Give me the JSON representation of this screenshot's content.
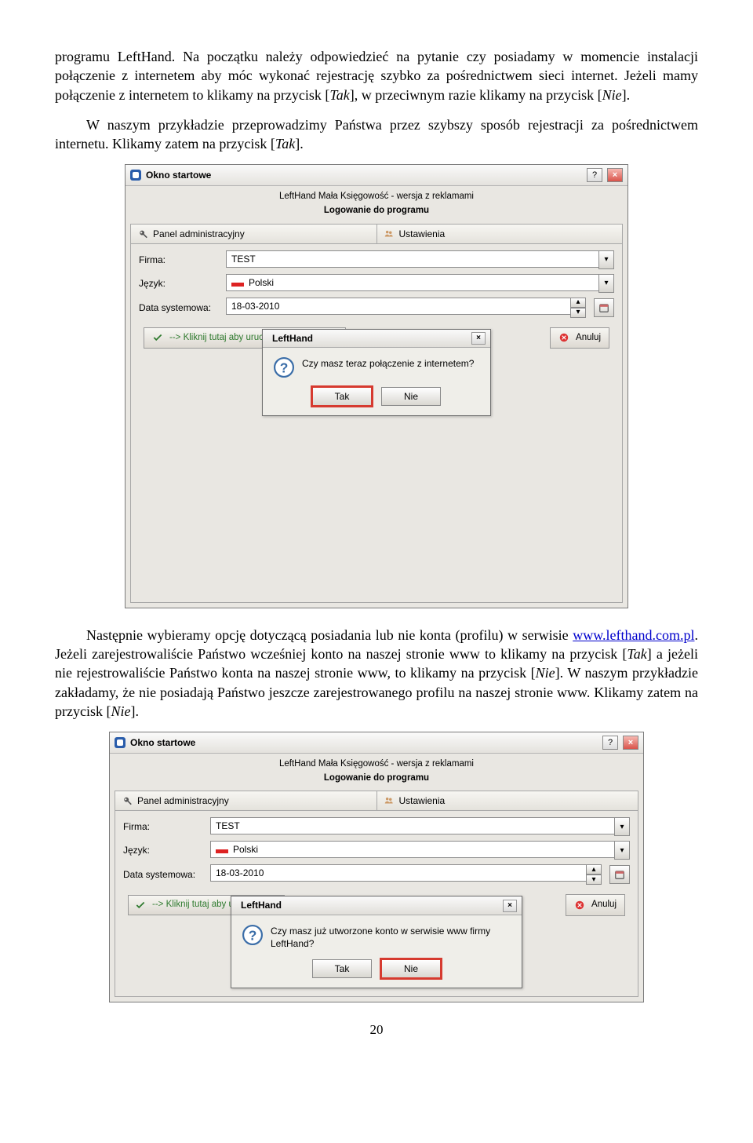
{
  "para1_a": "programu LeftHand. Na początku należy odpowiedzieć na pytanie czy posiadamy w momencie instalacji połączenie z internetem aby móc wykonać rejestrację szybko za pośrednictwem sieci internet. Jeżeli mamy połączenie z internetem to klikamy na przycisk [",
  "para1_i1": "Tak",
  "para1_b": "], w przeciwnym razie klikamy na przycisk [",
  "para1_i2": "Nie",
  "para1_c": "].",
  "para2_a": "W naszym przykładzie przeprowadzimy Państwa przez szybszy sposób rejestracji za pośrednictwem internetu. Klikamy zatem na przycisk [",
  "para2_i1": "Tak",
  "para2_b": "].",
  "para3_a": "Następnie wybieramy opcję dotyczącą posiadania lub nie konta (profilu) w serwisie ",
  "para3_link": "www.lefthand.com.pl",
  "para3_b": ". Jeżeli zarejestrowaliście Państwo wcześniej konto na naszej stronie www to klikamy na przycisk [",
  "para3_i1": "Tak",
  "para3_c": "] a jeżeli nie rejestrowaliście Państwo konta na naszej stronie www, to klikamy na przycisk [",
  "para3_i2": "Nie",
  "para3_d": "]. W naszym przykładzie zakładamy, że nie posiadają Państwo jeszcze zarejestrowanego profilu na naszej stronie www. Klikamy zatem na przycisk [",
  "para3_i3": "Nie",
  "para3_e": "].",
  "win": {
    "title": "Okno startowe",
    "sub1": "LeftHand Mała Księgowość - wersja z reklamami",
    "sub2": "Logowanie do programu",
    "tab_admin": "Panel administracyjny",
    "tab_settings": "Ustawienia",
    "lbl_firma": "Firma:",
    "val_firma": "TEST",
    "lbl_lang": "Język:",
    "val_lang": "Polski",
    "lbl_date": "Data systemowa:",
    "val_date": "18-03-2010",
    "launch": "--> Kliknij tutaj aby uruchomić program <--",
    "launch_short": "--> Kliknij tutaj aby uruchomić p",
    "cancel": "Anuluj"
  },
  "dlg": {
    "title": "LeftHand",
    "q1": "Czy masz teraz połączenie z internetem?",
    "q2": "Czy masz już utworzone konto w serwisie www firmy LeftHand?",
    "yes": "Tak",
    "no": "Nie"
  },
  "pagenum": "20"
}
